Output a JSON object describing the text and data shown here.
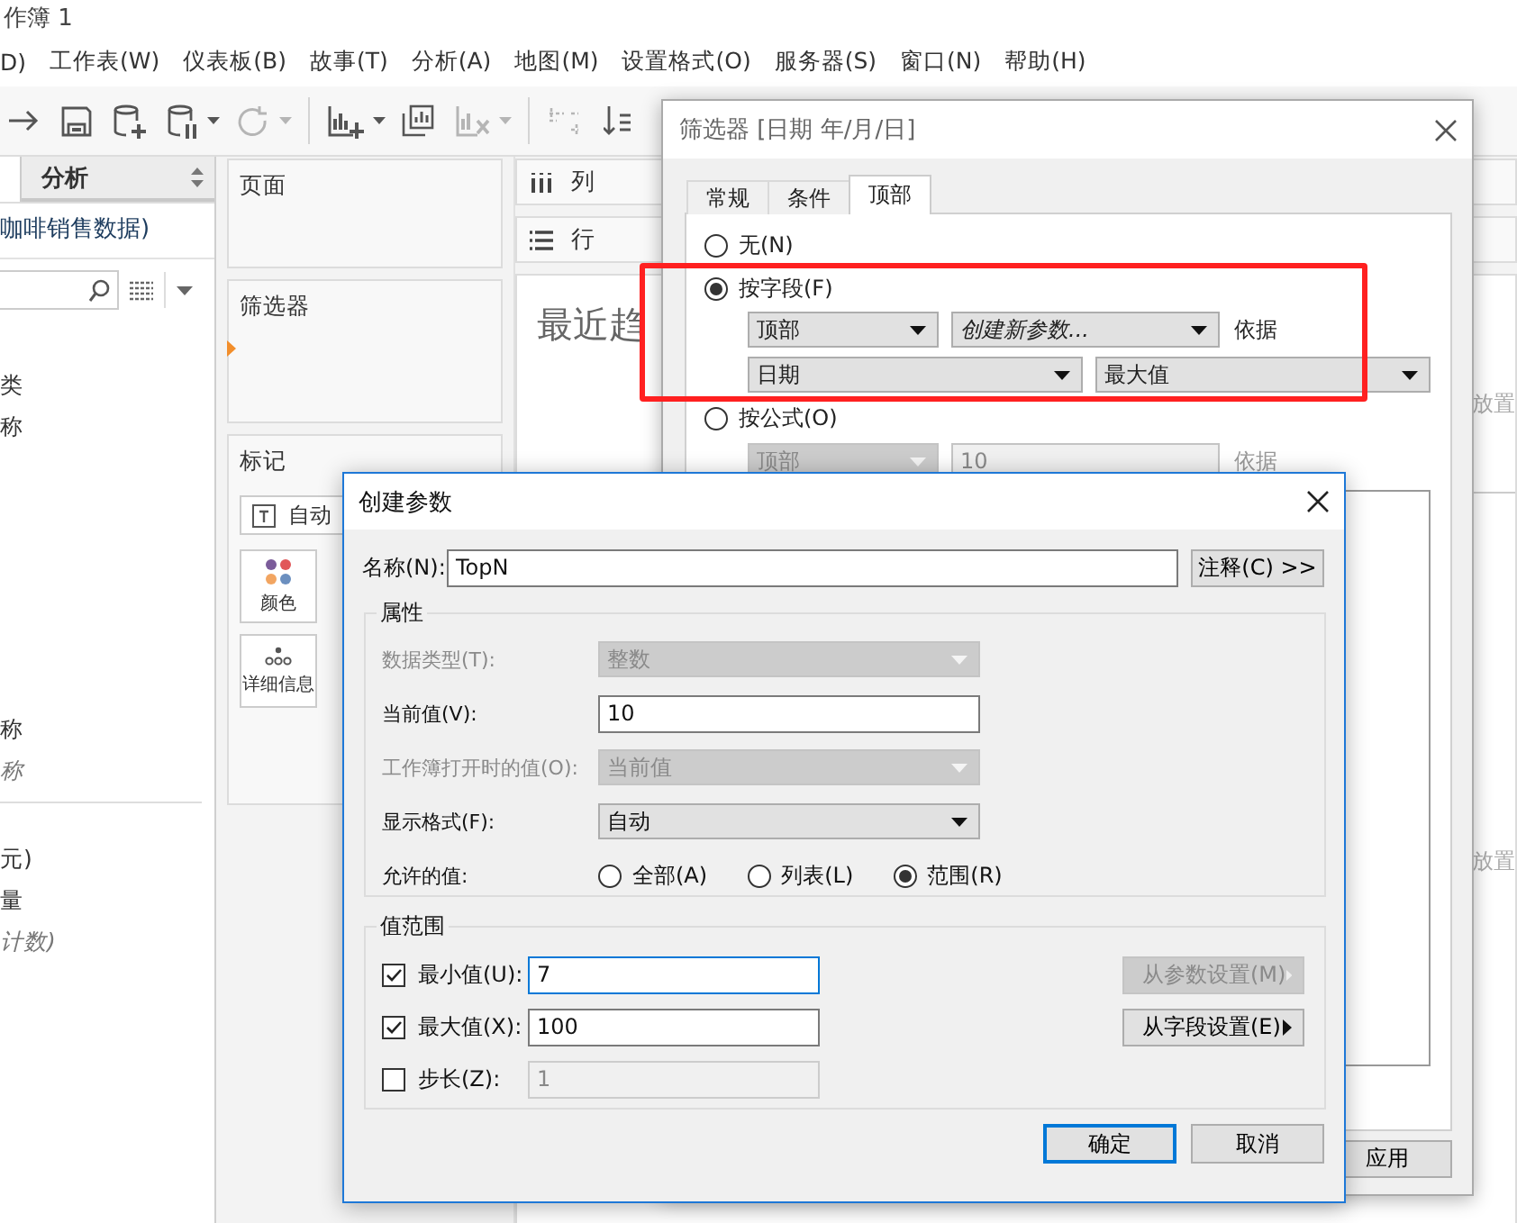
{
  "app": {
    "title": "作簿 1",
    "menu": [
      "D)",
      "工作表(W)",
      "仪表板(B)",
      "故事(T)",
      "分析(A)",
      "地图(M)",
      "设置格式(O)",
      "服务器(S)",
      "窗口(N)",
      "帮助(H)"
    ],
    "toolbar": [
      {
        "kind": "redo",
        "disabled": false
      },
      {
        "kind": "save",
        "disabled": false
      },
      {
        "kind": "add-data",
        "disabled": false
      },
      {
        "kind": "pause-data",
        "disabled": false
      },
      {
        "kind": "caret",
        "disabled": false
      },
      {
        "kind": "refresh",
        "disabled": true
      },
      {
        "kind": "caret",
        "disabled": true
      },
      {
        "kind": "separator"
      },
      {
        "kind": "new-sheet",
        "disabled": false
      },
      {
        "kind": "caret",
        "disabled": false
      },
      {
        "kind": "duplicate",
        "disabled": false
      },
      {
        "kind": "clear",
        "disabled": true
      },
      {
        "kind": "caret",
        "disabled": true
      },
      {
        "kind": "separator"
      },
      {
        "kind": "swap",
        "disabled": true
      },
      {
        "kind": "sort",
        "disabled": false
      }
    ],
    "data_pane": {
      "tab": {
        "label": "分析",
        "selected": false
      },
      "source": "咖啡销售数据)",
      "dimension_groups": [
        [
          {
            "text": "类",
            "kind": "field"
          },
          {
            "text": "称",
            "kind": "field"
          }
        ],
        [
          {
            "text": "称",
            "kind": "field"
          },
          {
            "text": "称",
            "kind": "generated"
          }
        ]
      ],
      "measures": [
        {
          "text": "元)",
          "kind": "field"
        },
        {
          "text": "量",
          "kind": "field"
        },
        {
          "text": "计数)",
          "kind": "generated"
        }
      ]
    },
    "shelves": {
      "pages": "页面",
      "filters": "筛选器",
      "marks": {
        "title": "标记",
        "mark_type": "自动",
        "cards": [
          {
            "kind": "color",
            "label": "颜色"
          },
          {
            "kind": "detail",
            "label": "详细信息"
          }
        ]
      }
    },
    "view": {
      "columns": "列",
      "rows": "行",
      "title": "最近趋",
      "drop_hints": [
        "放置",
        "放置"
      ]
    }
  },
  "filter_dialog": {
    "title": "筛选器 [日期 年/月/日]",
    "tabs": [
      {
        "label": "常规",
        "selected": false
      },
      {
        "label": "条件",
        "selected": false
      },
      {
        "label": "顶部",
        "selected": true
      }
    ],
    "options": [
      {
        "label": "无(N)",
        "selected": false
      },
      {
        "label": "按字段(F)",
        "selected": true,
        "rows": [
          [
            {
              "kind": "select",
              "value": "顶部",
              "disabled": false
            },
            {
              "kind": "action",
              "value": "创建新参数...",
              "disabled": false
            },
            {
              "kind": "label",
              "value": "依据",
              "disabled": false
            }
          ],
          [
            {
              "kind": "select",
              "value": "日期",
              "disabled": false
            },
            {
              "kind": "select",
              "value": "最大值",
              "disabled": false
            }
          ]
        ]
      },
      {
        "label": "按公式(O)",
        "selected": false,
        "rows": [
          [
            {
              "kind": "select",
              "value": "顶部",
              "disabled": true
            },
            {
              "kind": "combo",
              "value": "10",
              "disabled": true
            },
            {
              "kind": "label",
              "value": "依据",
              "disabled": true
            }
          ]
        ]
      }
    ],
    "apply_button": "应用"
  },
  "highlight": {
    "kind": "rectangle"
  },
  "param_dialog": {
    "title": "创建参数",
    "name_label": "名称(N):",
    "name_value": "TopN",
    "comment_button": "注释(C) >>",
    "properties": {
      "legend": "属性",
      "rows": [
        {
          "kind": "select",
          "label": "数据类型(T):",
          "value": "整数",
          "disabled": true
        },
        {
          "kind": "input",
          "label": "当前值(V):",
          "value": "10",
          "disabled": false
        },
        {
          "kind": "select",
          "label": "工作簿打开时的值(O):",
          "value": "当前值",
          "disabled": true
        },
        {
          "kind": "select",
          "label": "显示格式(F):",
          "value": "自动",
          "disabled": false
        },
        {
          "kind": "radios",
          "label": "允许的值:",
          "options": [
            {
              "label": "全部(A)",
              "selected": false
            },
            {
              "label": "列表(L)",
              "selected": false
            },
            {
              "label": "范围(R)",
              "selected": true
            }
          ]
        }
      ]
    },
    "range": {
      "legend": "值范围",
      "rows": [
        {
          "label": "最小值(U):",
          "checked": true,
          "value": "7",
          "disabled": false,
          "focused": true
        },
        {
          "label": "最大值(X):",
          "checked": true,
          "value": "100",
          "disabled": false,
          "focused": false
        },
        {
          "label": "步长(Z):",
          "checked": false,
          "value": "1",
          "disabled": true,
          "focused": false
        }
      ],
      "buttons": [
        {
          "label": "从参数设置(M)",
          "disabled": true
        },
        {
          "label": "从字段设置(E)",
          "disabled": false
        }
      ]
    },
    "footer": [
      {
        "label": "确定",
        "default": true
      },
      {
        "label": "取消",
        "default": false
      }
    ]
  }
}
